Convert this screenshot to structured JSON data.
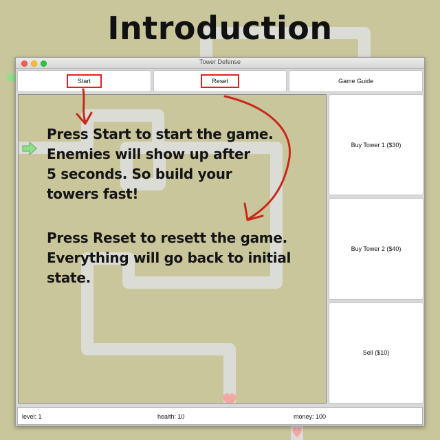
{
  "intro_title": "Introduction",
  "window": {
    "title": "Tower Defense"
  },
  "toolbar": {
    "start_label": "Start",
    "reset_label": "Reset",
    "guide_label": "Game Guide"
  },
  "side_panel": {
    "buy_tower_1": "Buy Tower 1 ($30)",
    "buy_tower_2": "Buy Tower 2 ($40)",
    "sell": "Sell ($10)"
  },
  "status": {
    "level": "level: 1",
    "health": "health: 10",
    "money": "money: 100"
  },
  "instructions": {
    "start_lines": [
      "Press Start to start the game.",
      "Enemies will show up after",
      "5 seconds. So build your",
      "towers fast!"
    ],
    "reset_lines": [
      "Press Reset to resett the game.",
      "Everything will go back to initial",
      "state."
    ]
  },
  "icons": {
    "spawn_arrow": "green-arrow-icon",
    "goal": "heart-icon",
    "annotation_arrows": "red-arrow-icon"
  },
  "colors": {
    "grass": "#c9c69c",
    "path": "#dcdcd6",
    "highlight_box": "#e01f1f",
    "annotation_arrow": "#c8281a",
    "spawn_arrow": "#8ee08a",
    "goal_heart": "#f1a7a2"
  }
}
